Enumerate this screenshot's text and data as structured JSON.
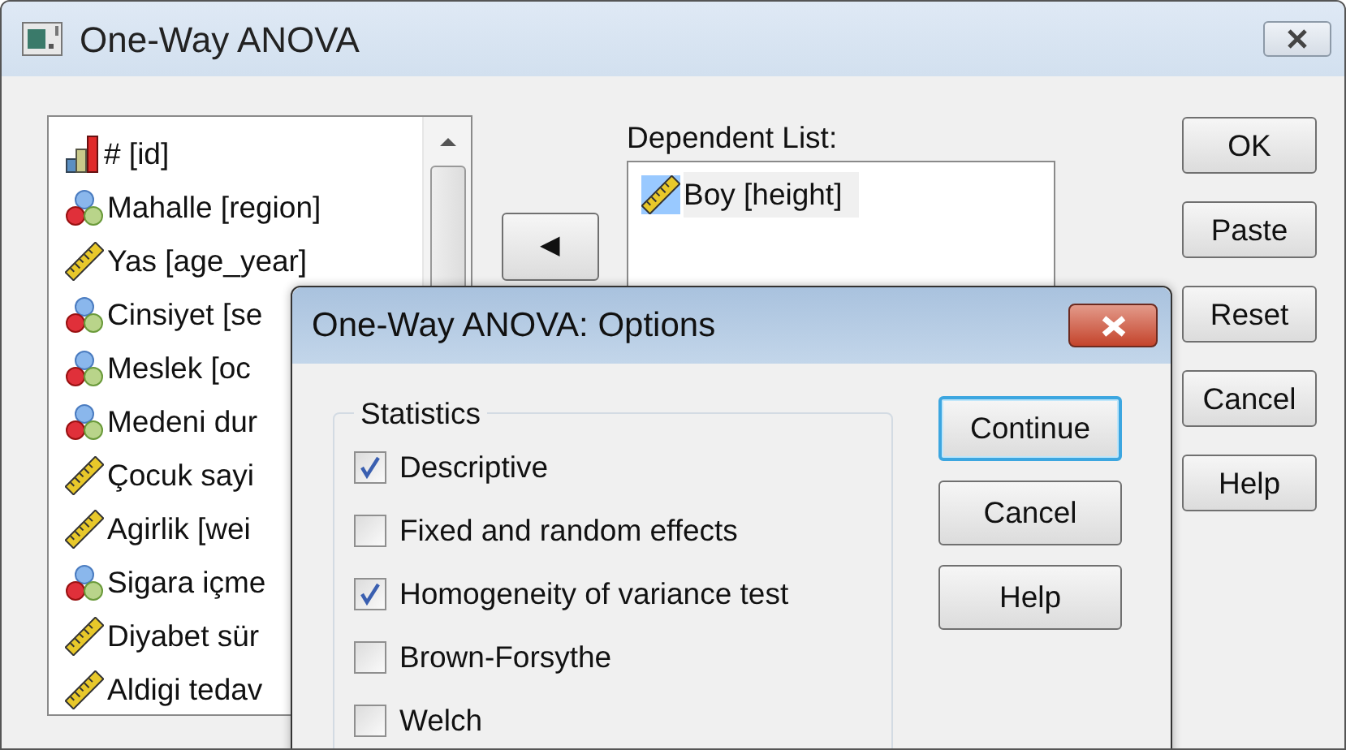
{
  "window": {
    "title": "One-Way ANOVA"
  },
  "variables": [
    {
      "kind": "ordinal",
      "label": "# [id]"
    },
    {
      "kind": "nominal",
      "label": "Mahalle [region]"
    },
    {
      "kind": "scale",
      "label": "Yas [age_year]"
    },
    {
      "kind": "nominal",
      "label": "Cinsiyet [se"
    },
    {
      "kind": "nominal",
      "label": "Meslek [oc"
    },
    {
      "kind": "nominal",
      "label": "Medeni dur"
    },
    {
      "kind": "scale",
      "label": "Çocuk sayi"
    },
    {
      "kind": "scale",
      "label": "Agirlik [wei"
    },
    {
      "kind": "nominal",
      "label": "Sigara içme"
    },
    {
      "kind": "scale",
      "label": "Diyabet sür"
    },
    {
      "kind": "scale",
      "label": "Aldigi tedav"
    }
  ],
  "move_button": {
    "label": "◀"
  },
  "dependent_list": {
    "label": "Dependent List:",
    "items": [
      {
        "kind": "scale",
        "label": "Boy [height]",
        "selected": true
      }
    ]
  },
  "buttons": [
    "OK",
    "Paste",
    "Reset",
    "Cancel",
    "Help"
  ],
  "options_dialog": {
    "title": "One-Way ANOVA: Options",
    "statistics": {
      "label": "Statistics",
      "options": [
        {
          "label": "Descriptive",
          "checked": true
        },
        {
          "label": "Fixed and random effects",
          "checked": false
        },
        {
          "label": "Homogeneity of variance test",
          "checked": true
        },
        {
          "label": "Brown-Forsythe",
          "checked": false
        },
        {
          "label": "Welch",
          "checked": false
        }
      ]
    },
    "buttons": [
      {
        "label": "Continue",
        "default": true
      },
      {
        "label": "Cancel",
        "default": false
      },
      {
        "label": "Help",
        "default": false
      }
    ]
  }
}
